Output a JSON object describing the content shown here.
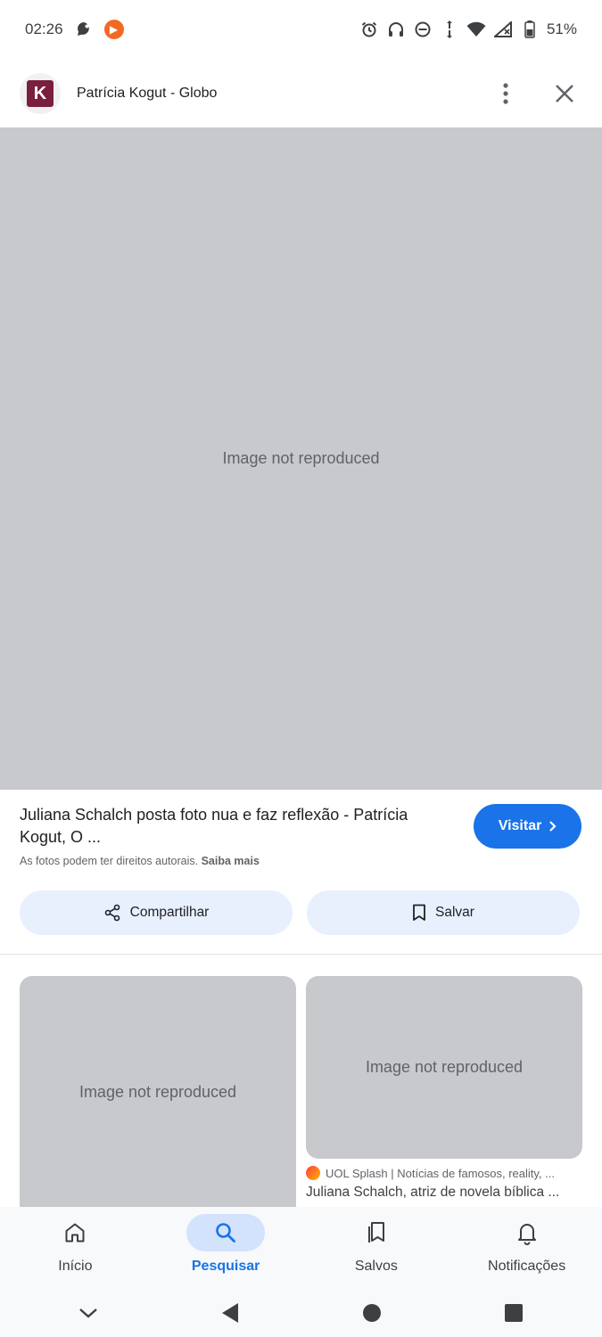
{
  "status_bar": {
    "time": "02:26",
    "battery": "51%",
    "icons": [
      "chat-notification-icon",
      "app-notification-icon",
      "alarm-icon",
      "headphones-icon",
      "dnd-icon",
      "data-arrows-icon",
      "wifi-icon",
      "signal-icon",
      "battery-icon"
    ]
  },
  "header": {
    "logo_letter": "K",
    "source_title": "Patrícia Kogut - Globo",
    "more_icon": "more-vert-icon",
    "close_icon": "close-icon"
  },
  "main_image": {
    "placeholder": "Image not reproduced"
  },
  "result": {
    "title": "Juliana Schalch posta foto nua e faz reflexão - Patrícia Kogut, O ...",
    "visit_label": "Visitar",
    "copyright_text": "As fotos podem ter direitos autorais.",
    "learn_more": "Saiba mais"
  },
  "actions": {
    "share_label": "Compartilhar",
    "save_label": "Salvar"
  },
  "related": {
    "item1_placeholder": "Image not reproduced",
    "item2_placeholder": "Image not reproduced",
    "item2_source": "UOL Splash | Notícias de famosos, reality, ...",
    "item2_title": "Juliana Schalch, atriz de novela bíblica ..."
  },
  "bottom_nav": {
    "items": [
      {
        "label": "Início",
        "icon": "home-icon"
      },
      {
        "label": "Pesquisar",
        "icon": "search-icon"
      },
      {
        "label": "Salvos",
        "icon": "bookmarks-icon"
      },
      {
        "label": "Notificações",
        "icon": "bell-icon"
      }
    ],
    "active": "Pesquisar"
  },
  "colors": {
    "accent": "#1a73e8",
    "action_bg": "#e8f0fe",
    "nav_active_bg": "#d3e3fd"
  }
}
